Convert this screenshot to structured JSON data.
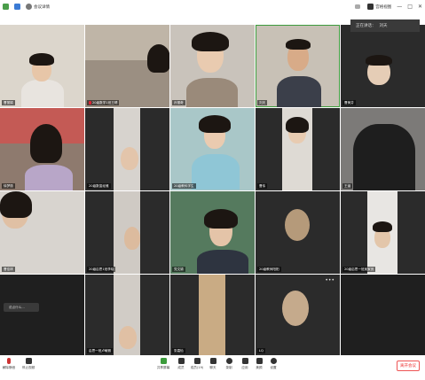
{
  "titlebar": {
    "meeting_info": "会议详情",
    "window_controls": [
      "—",
      "□",
      "✕"
    ],
    "view_label": "宫格视图"
  },
  "speaking": {
    "label": "正在讲话：",
    "name": "刘天"
  },
  "tiles": [
    {
      "name": "曹丽娟"
    },
    {
      "name": "20级数学1班王晴",
      "muted": true
    },
    {
      "name": "孙丽奇"
    },
    {
      "name": "刘天"
    },
    {
      "name": "曹美芬"
    },
    {
      "name": "徐梦丽"
    },
    {
      "name": "20级数富经雅"
    },
    {
      "name": "20级教科学生"
    },
    {
      "name": "曹伟"
    },
    {
      "name": "王涵"
    },
    {
      "name": "曹佳琪"
    },
    {
      "name": "20级启思1班李晓"
    },
    {
      "name": "党文锦"
    },
    {
      "name": "20级教师阳阳"
    },
    {
      "name": "20级启思一班吴家良"
    },
    {
      "name": "说点什么..."
    },
    {
      "name": "启思一班卢敏雅"
    },
    {
      "name": "张嘉怡"
    },
    {
      "name": "LQ"
    },
    {
      "name": ""
    }
  ],
  "toolbar": {
    "mute_label": "解除静音",
    "video_label": "停止视频",
    "share_label": "共享屏幕",
    "members_label": "成员(19)",
    "chat_label": "聊天",
    "record_label": "录制",
    "apps_label": "应用",
    "effects_label": "美颜",
    "settings_label": "设置",
    "leave_label": "离开会议",
    "more_label": "成员"
  },
  "colors": {
    "accent_green": "#3c9b3c",
    "leave_red": "#e33333",
    "tile_dark": "#2a2a2a"
  }
}
